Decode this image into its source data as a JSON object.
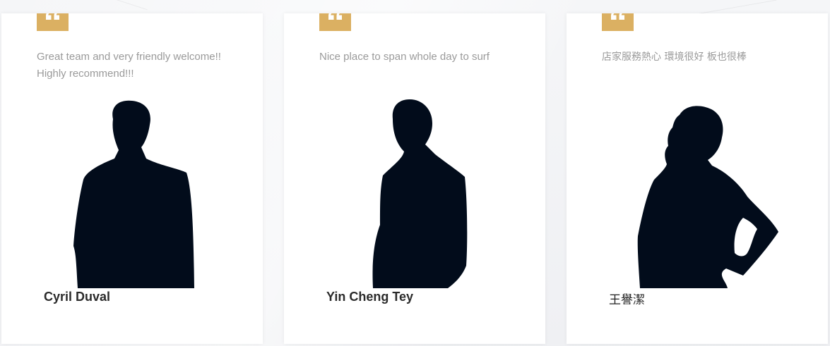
{
  "colors": {
    "accent": "#dbb062",
    "card_background": "#ffffff",
    "review_text": "#9a9a9a",
    "name_text": "#2b2b2b",
    "silhouette": "#020c1b"
  },
  "testimonials": [
    {
      "review": "Great team and very friendly welcome!! Highly recommend!!!",
      "name": "Cyril Duval",
      "icon": "quote-icon",
      "photo": "man-silhouette-icon"
    },
    {
      "review": "Nice place to span whole day to surf",
      "name": "Yin Cheng Tey",
      "icon": "quote-icon",
      "photo": "man-silhouette-icon"
    },
    {
      "review": "店家服務熱心 環境很好 板也很棒",
      "name": "王譽潔",
      "icon": "quote-icon",
      "photo": "woman-silhouette-icon"
    }
  ]
}
